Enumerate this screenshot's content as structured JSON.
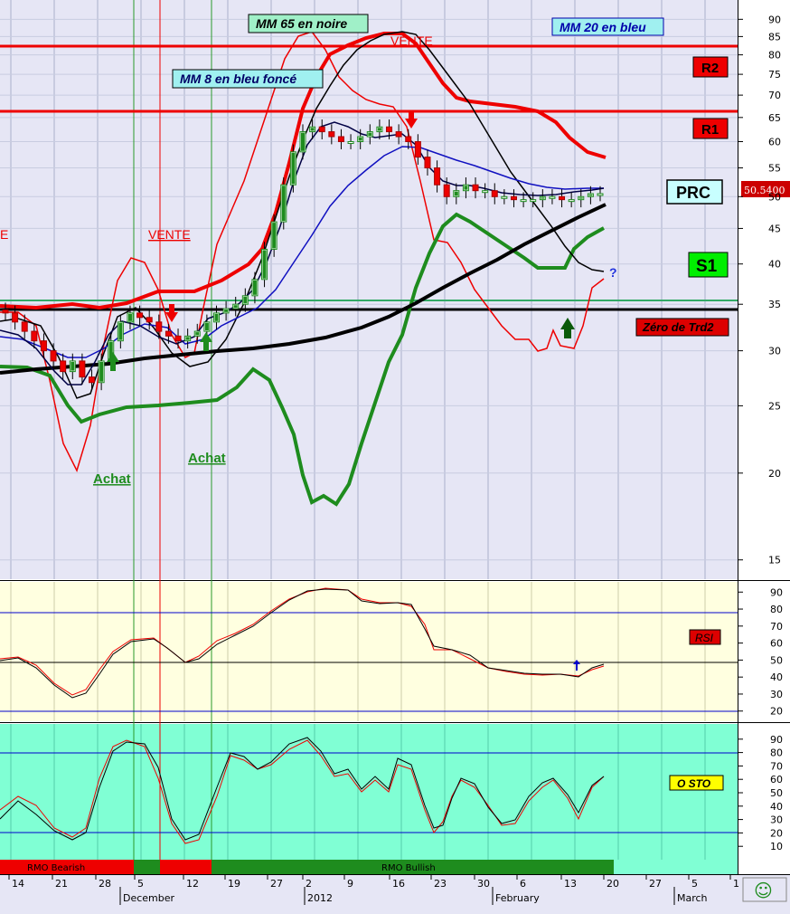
{
  "colors": {
    "main_bg": "#e6e6f5",
    "rsi_bg": "#ffffe0",
    "sto_bg": "#80ffd4",
    "red": "#ee0000",
    "green": "#1e8c1e",
    "blue": "#0000cc",
    "black": "#000000"
  },
  "labels": {
    "mm65": "MM 65 en noire",
    "mm20": "MM 20 en bleu",
    "mm8": "MM 8 en bleu foncé",
    "vente_top": "VENTE",
    "vente_mid": "VENTE",
    "vente_left": "E",
    "achat1": "Achat",
    "achat2": "Achat",
    "r2": "R2",
    "r1": "R1",
    "prc": "PRC",
    "price": "50.5400",
    "s1": "S1",
    "zero_trd2": "Zéro de Trd2",
    "question": "?",
    "rsi": "RSI",
    "osto": "O STO",
    "rmo_bearish": "RMO Bearish",
    "rmo_bullish": "RMO Bullish",
    "smiley": "☺"
  },
  "axes": {
    "price_ticks": [
      "90",
      "85",
      "80",
      "75",
      "70",
      "65",
      "60",
      "55",
      "50",
      "45",
      "40",
      "35",
      "30",
      "25",
      "20",
      "15"
    ],
    "rsi_ticks": [
      "90",
      "80",
      "70",
      "60",
      "50",
      "40",
      "30",
      "20"
    ],
    "sto_ticks": [
      "90",
      "80",
      "70",
      "60",
      "50",
      "40",
      "30",
      "20",
      "10"
    ],
    "date_ticks": [
      "14",
      "21",
      "28",
      "5",
      "12",
      "19",
      "27",
      "2",
      "9",
      "16",
      "23",
      "30",
      "6",
      "13",
      "20",
      "27",
      "5",
      "1"
    ],
    "months": [
      "December",
      "2012",
      "February",
      "March"
    ]
  },
  "chart_data": [
    {
      "type": "candlestick",
      "title": "",
      "y_scale": "log",
      "ylim": [
        15,
        92
      ],
      "levels": {
        "R2": 80.5,
        "R1": 65.0,
        "green_line": 35.5,
        "zero_trd2": 34.5
      },
      "close_series": [
        34,
        33,
        32,
        31,
        30,
        29,
        28,
        29,
        27.5,
        27,
        29,
        31,
        33,
        34,
        33.5,
        33,
        32,
        31.5,
        31,
        31.5,
        32,
        33,
        34,
        34.5,
        35,
        36,
        38,
        42,
        46,
        52,
        58,
        62,
        63,
        62,
        61,
        60,
        60,
        61,
        62,
        63,
        62,
        61,
        60,
        57,
        55,
        52,
        50,
        51,
        52,
        51,
        51,
        50,
        50,
        49.5,
        49.5,
        49.5,
        50,
        50,
        49.5,
        49.5,
        50,
        50.5,
        50.5
      ]
    },
    {
      "type": "line",
      "title": "",
      "name_label": "RSI",
      "ylim": [
        15,
        95
      ],
      "levels": [
        80,
        50,
        20
      ],
      "series": [
        {
          "name": "RSI",
          "values": [
            52,
            52,
            48,
            38,
            30,
            27,
            34,
            48,
            58,
            63,
            65,
            66,
            60,
            52,
            50,
            52,
            60,
            65,
            68,
            72,
            78,
            86,
            90,
            92,
            93,
            92,
            91,
            87,
            86,
            86,
            84,
            80,
            58,
            52,
            48,
            45,
            43,
            42,
            42,
            42,
            43,
            42,
            42,
            45,
            48
          ]
        }
      ]
    },
    {
      "type": "line",
      "title": "",
      "name_label": "O STO",
      "ylim": [
        2,
        97
      ],
      "levels": [
        80,
        20
      ],
      "series": [
        {
          "name": "O STO",
          "values": [
            28,
            45,
            50,
            35,
            20,
            18,
            30,
            75,
            90,
            88,
            78,
            45,
            15,
            12,
            40,
            80,
            75,
            68,
            80,
            88,
            90,
            75,
            62,
            68,
            50,
            62,
            50,
            75,
            55,
            15,
            40,
            65,
            55,
            45,
            27,
            30,
            45,
            60,
            62,
            48,
            32,
            55,
            62
          ]
        }
      ]
    }
  ]
}
